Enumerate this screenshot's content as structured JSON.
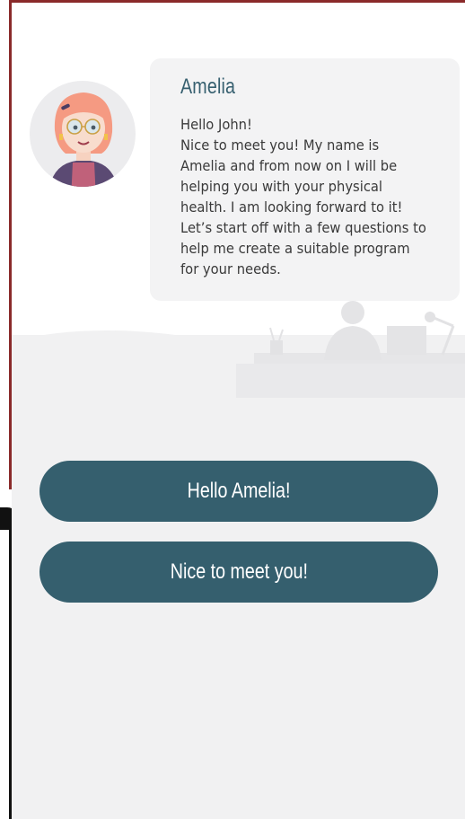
{
  "chat": {
    "assistant_name": "Amelia",
    "message": "Hello John!\nNice to meet you! My name is Amelia and from now on I will be helping you with your physical health.  I am looking forward to it! Let’s start off with a few questions to help me create a suitable program for your needs."
  },
  "replies": [
    {
      "label": "Hello Amelia!"
    },
    {
      "label": "Nice to meet you!"
    }
  ],
  "colors": {
    "accent": "#355f6e",
    "name_text": "#365f6f",
    "bubble_bg": "#f3f3f4",
    "ground_bg": "#f1f1f2"
  },
  "icons": {
    "avatar": "woman-with-glasses-avatar"
  }
}
